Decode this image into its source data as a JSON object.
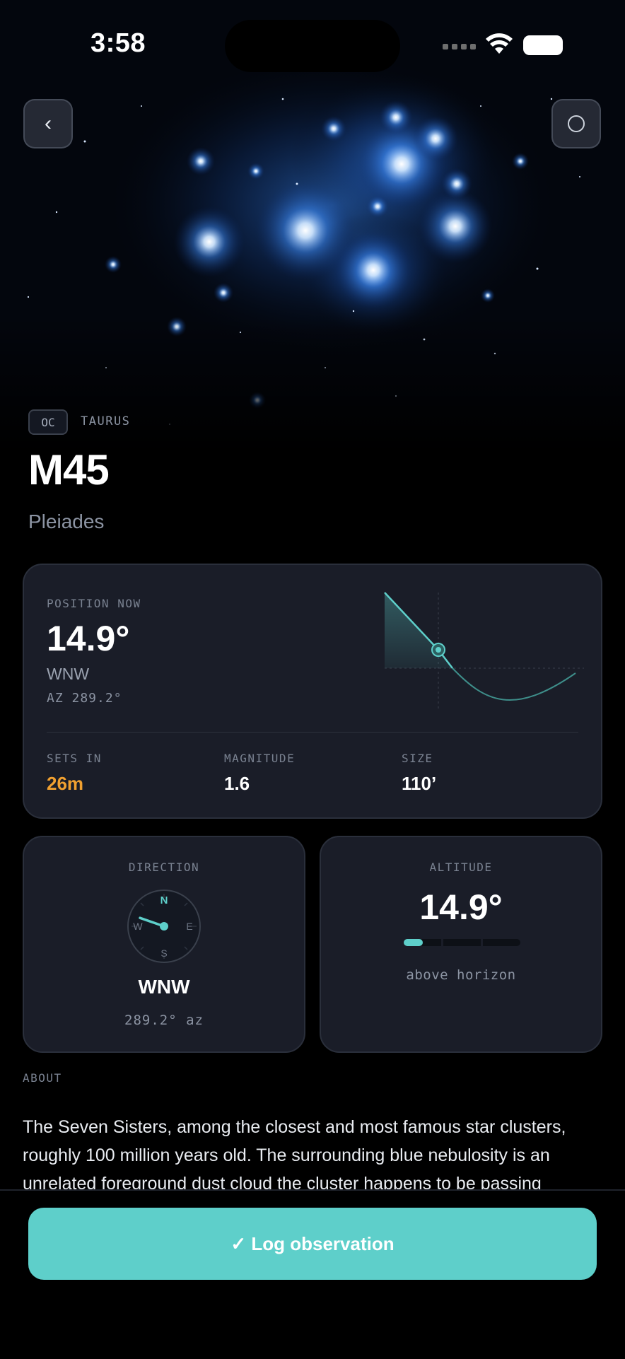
{
  "status_bar": {
    "time": "3:58"
  },
  "hero": {
    "back_icon": "chevron-left-icon",
    "save_icon": "circle-icon",
    "back_glyph": "‹"
  },
  "object": {
    "type_badge": "OC",
    "constellation": "TAURUS",
    "title": "M45",
    "subtitle": "Pleiades"
  },
  "position": {
    "label": "POSITION NOW",
    "altitude": "14.9°",
    "direction": "WNW",
    "azimuth": "AZ 289.2°",
    "stats": [
      {
        "label": "SETS IN",
        "value": "26m",
        "color": "#f0a030"
      },
      {
        "label": "MAGNITUDE",
        "value": "1.6",
        "color": "#ffffff"
      },
      {
        "label": "SIZE",
        "value": "110’",
        "color": "#ffffff"
      }
    ]
  },
  "direction_card": {
    "label": "DIRECTION",
    "compass": {
      "n": "N",
      "e": "E",
      "s": "S",
      "w": "W",
      "azimuth_deg": 289.2
    },
    "value": "WNW",
    "azimuth": "289.2° az"
  },
  "altitude_card": {
    "label": "ALTITUDE",
    "value": "14.9°",
    "fraction": 0.166,
    "caption": "above horizon"
  },
  "about": {
    "label": "ABOUT",
    "text": "The Seven Sisters, among the closest and most famous star clusters, roughly 100 million years old. The surrounding blue nebulosity is an unrelated foreground dust cloud the cluster happens to be passing"
  },
  "action": {
    "log_label": "✓ Log observation"
  },
  "colors": {
    "accent": "#5ecfca",
    "warning": "#f0a030",
    "card": "#1a1d28"
  }
}
